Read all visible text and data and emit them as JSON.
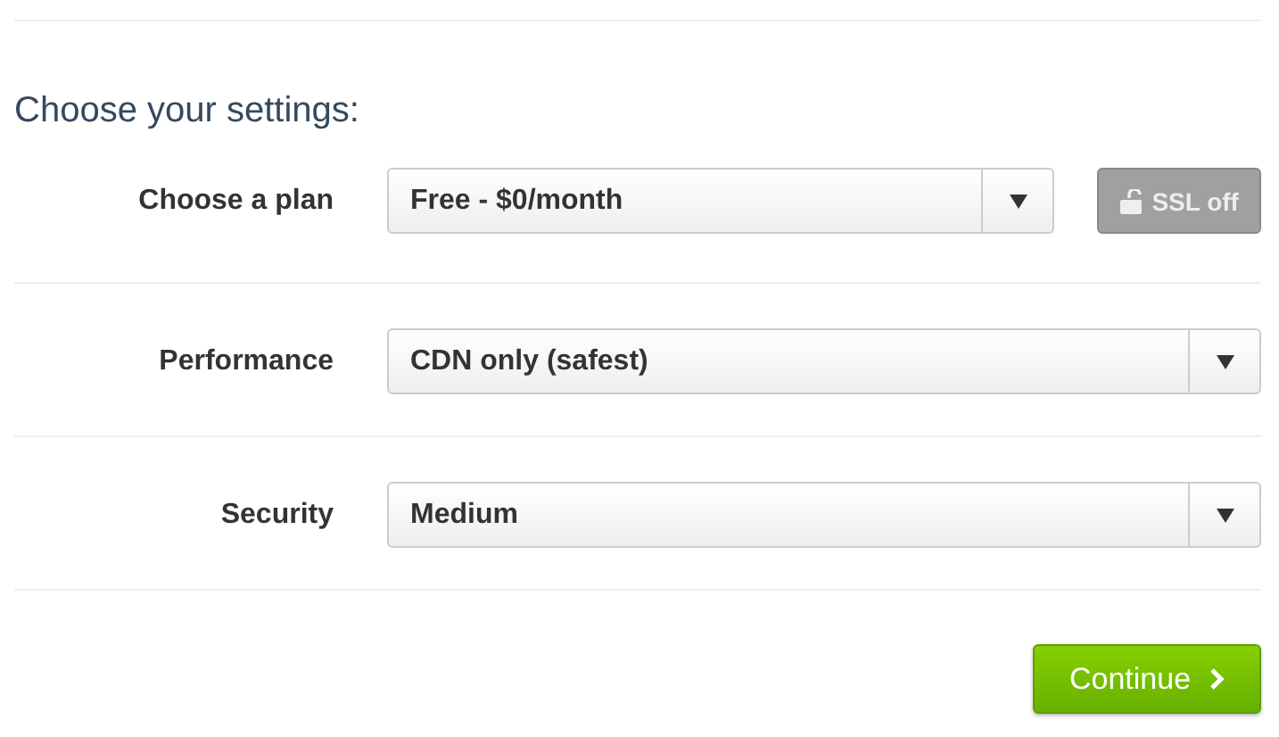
{
  "heading": "Choose your settings:",
  "settings": [
    {
      "label": "Choose a plan",
      "value": "Free - $0/month",
      "ssl": {
        "label": "SSL off",
        "on": false
      }
    },
    {
      "label": "Performance",
      "value": "CDN only (safest)"
    },
    {
      "label": "Security",
      "value": "Medium"
    }
  ],
  "continue_button": {
    "label": "Continue"
  }
}
